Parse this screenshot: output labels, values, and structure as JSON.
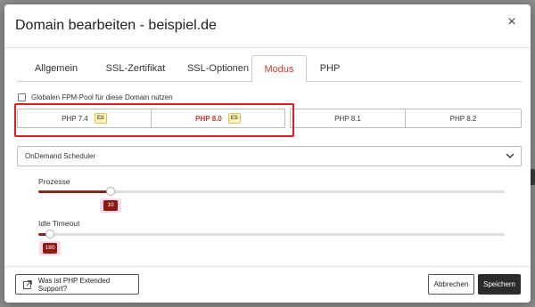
{
  "dialog": {
    "title": "Domain bearbeiten - beispiel.de",
    "close_label": "×"
  },
  "tabs": [
    {
      "label": "Allgemein",
      "active": false
    },
    {
      "label": "SSL-Zertifikat",
      "active": false
    },
    {
      "label": "SSL-Optionen",
      "active": false
    },
    {
      "label": "Modus",
      "active": true
    },
    {
      "label": "PHP",
      "active": false
    }
  ],
  "fpm_checkbox": {
    "label": "Globalen FPM-Pool für diese Domain nutzen",
    "checked": false
  },
  "php_versions": [
    {
      "label": "PHP 7.4",
      "badge": "ES",
      "selected": false
    },
    {
      "label": "PHP 8.0",
      "badge": "ES",
      "selected": true
    },
    {
      "label": "PHP 8.1",
      "badge": "",
      "selected": false
    },
    {
      "label": "PHP 8.2",
      "badge": "",
      "selected": false
    }
  ],
  "scheduler": {
    "selected": "OnDemand Scheduler",
    "icon": "chevron-down-icon"
  },
  "sliders": {
    "prozesse": {
      "label": "Prozesse",
      "value": "10",
      "fraction": 0.155
    },
    "idle_timeout": {
      "label": "Idle Timeout",
      "value": "180",
      "fraction": 0.025
    }
  },
  "footer": {
    "help_label": "Was ist PHP Extended Support?",
    "cancel_label": "Abbrechen",
    "save_label": "Speichern"
  },
  "colors": {
    "accent": "#c0392b",
    "slider_fill": "#7b2b22",
    "highlight": "#e01e1e",
    "primary_button": "#2b2b2b"
  }
}
